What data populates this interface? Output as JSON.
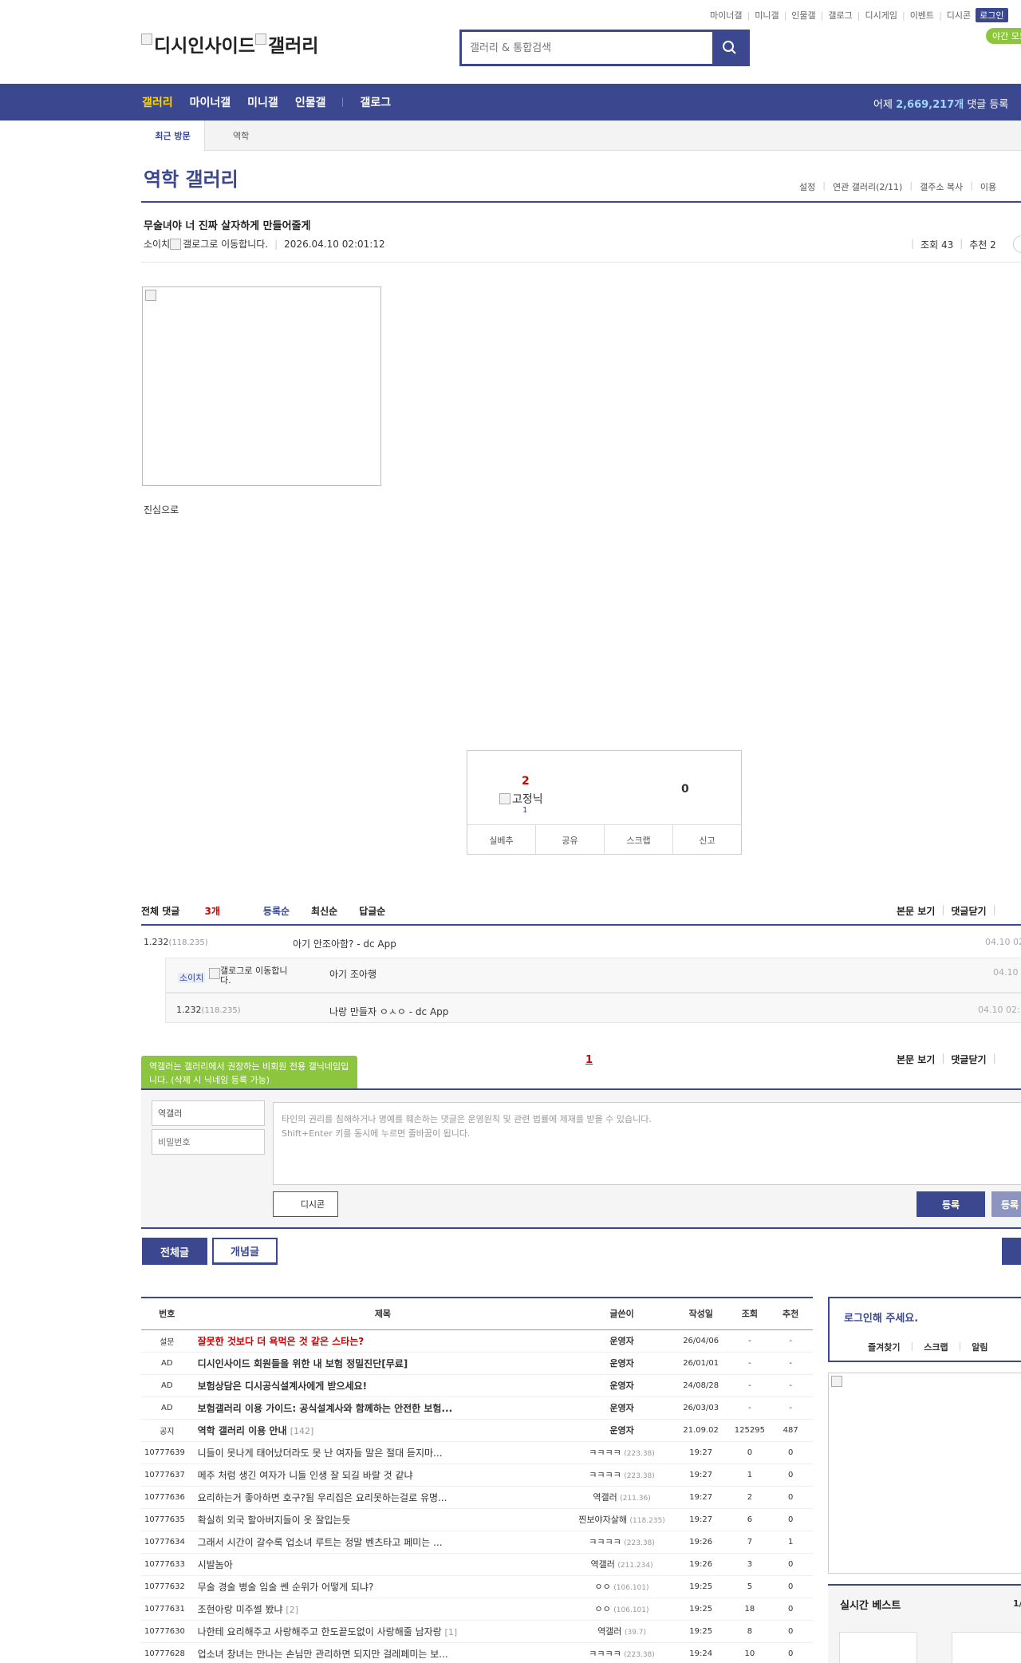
{
  "topnav": {
    "items": [
      "마이너갤",
      "미니갤",
      "인물갤",
      "갤로그",
      "디시게임",
      "이벤트",
      "디시콘"
    ],
    "login": "로그인",
    "night": "야간 모드"
  },
  "header": {
    "logo_text_1": "디시인사이드",
    "logo_text_2": "갤러리",
    "search_placeholder": "갤러리 & 통합검색"
  },
  "gnb": {
    "items": [
      "갤러리",
      "마이너갤",
      "미니갤",
      "인물갤"
    ],
    "item_extra": "갤로그",
    "stat_prefix": "어제 ",
    "stat_value": "2,669,217개",
    "stat_suffix": " 댓글 등록"
  },
  "visit": {
    "title": "최근 방문",
    "item": "역학"
  },
  "gallery": {
    "title": "역학 갤러리",
    "links": [
      "설정",
      "연관 갤러리(2/11)",
      "갤주소 복사",
      "이용"
    ]
  },
  "post": {
    "title": "무술녀야 너 진짜 살자하게 만들어줄게",
    "author": "소이치",
    "gallog_alt": "갤로그로 이동합니다.",
    "date": "2026.04.10 02:01:12",
    "views": "조회 43",
    "recommend": "추천 2",
    "body_text": "진심으로"
  },
  "reco": {
    "up": "2",
    "fixed_label": "고정닉",
    "fixed_count": "1",
    "down": "0",
    "buttons": [
      "실베추",
      "공유",
      "스크랩",
      "신고"
    ]
  },
  "comments": {
    "header_prefix": "전체 댓글 ",
    "count": "3개",
    "tabs": [
      "등록순",
      "최신순",
      "답글순"
    ],
    "right": [
      "본문 보기",
      "댓글닫기"
    ],
    "items": [
      {
        "nick": "1.232",
        "ip": "(118.235)",
        "text": "아기 안조아함? - dc App",
        "date": "04.10 02"
      },
      {
        "nick": "소이치",
        "gallog": "갤로그로 이동합니다.",
        "text": "아기 조아행",
        "date": "04.10"
      },
      {
        "nick": "1.232",
        "ip": "(118.235)",
        "text": "나랑 만들자 ㅇㅅㅇ - dc App",
        "date": "04.10 02:"
      }
    ],
    "page": "1",
    "right2": [
      "본문 보기",
      "댓글닫기"
    ]
  },
  "write": {
    "tooltip": "역갤러는 갤러리에서 권장하는 비회원 전용 갤닉네임입니다. (삭제 시 닉네임 등록 가능)",
    "nick_value": "역갤러",
    "password_placeholder": "비밀번호",
    "textarea_placeholder_1": "타인의 권리를 침해하거나 명예를 훼손하는 댓글은 운영원칙 및 관련 법률에 제재를 받을 수 있습니다.",
    "textarea_placeholder_2": "Shift+Enter 키를 동시에 누르면 줄바꿈이 됩니다.",
    "dccon": "디시콘",
    "register": "등록",
    "register2": "등록"
  },
  "listbtns": {
    "all": "전체글",
    "concept": "개념글"
  },
  "table": {
    "headers": [
      "번호",
      "제목",
      "글쓴이",
      "작성일",
      "조회",
      "추천"
    ],
    "rows": [
      {
        "num": "설문",
        "title": "잘못한 것보다 더 욕먹은 것 같은 스타는?",
        "writer": "운영자",
        "ip": "",
        "date": "26/04/06",
        "views": "-",
        "rec": "-",
        "style": "red"
      },
      {
        "num": "AD",
        "title": "디시인사이드 회원들을 위한 내 보험 정밀진단[무료]",
        "writer": "운영자",
        "ip": "",
        "date": "26/01/01",
        "views": "-",
        "rec": "-",
        "style": "b"
      },
      {
        "num": "AD",
        "title": "보험상담은 디시공식설계사에게 받으세요!",
        "writer": "운영자",
        "ip": "",
        "date": "24/08/28",
        "views": "-",
        "rec": "-",
        "style": "b"
      },
      {
        "num": "AD",
        "title": "보험갤러리 이용 가이드: 공식설계사와 함께하는 안전한 보험...",
        "writer": "운영자",
        "ip": "",
        "date": "26/03/03",
        "views": "-",
        "rec": "-",
        "style": "b"
      },
      {
        "num": "공지",
        "title": "역학 갤러리 이용 안내",
        "reply": "[142]",
        "writer": "운영자",
        "ip": "",
        "date": "21.09.02",
        "views": "125295",
        "rec": "487",
        "style": "b"
      },
      {
        "num": "10777639",
        "title": "니들이 못나게 태어났더라도 못 난 여자들 말은 절대 듣지마...",
        "writer": "ㅋㅋㅋㅋ",
        "ip": "(223.38)",
        "date": "19:27",
        "views": "0",
        "rec": "0"
      },
      {
        "num": "10777637",
        "title": "메주 처럼 생긴 여자가 니들 인생 잘 되길 바랄 것 같냐",
        "writer": "ㅋㅋㅋㅋ",
        "ip": "(223.38)",
        "date": "19:27",
        "views": "1",
        "rec": "0"
      },
      {
        "num": "10777636",
        "title": "요리하는거 좋아하면 호구?됨 우리집은 요리못하는걸로 유명...",
        "writer": "역갤러",
        "ip": "(211.36)",
        "date": "19:27",
        "views": "2",
        "rec": "0"
      },
      {
        "num": "10777635",
        "title": "확실히 외국 할아버지들이 옷 잘입는듯",
        "writer": "찐보야자살해",
        "ip": "(118.235)",
        "date": "19:27",
        "views": "6",
        "rec": "0"
      },
      {
        "num": "10777634",
        "title": "그래서 시간이 갈수록 업소녀 루트는 정말 벤츠타고 페미는 ...",
        "writer": "ㅋㅋㅋㅋ",
        "ip": "(223.38)",
        "date": "19:26",
        "views": "7",
        "rec": "1"
      },
      {
        "num": "10777633",
        "title": "시발놈아",
        "writer": "역갤러",
        "ip": "(211.234)",
        "date": "19:26",
        "views": "3",
        "rec": "0"
      },
      {
        "num": "10777632",
        "title": "무술 경술 병술 임술 쎈 순위가 어떻게 되냐?",
        "writer": "ㅇㅇ",
        "ip": "(106.101)",
        "date": "19:25",
        "views": "5",
        "rec": "0"
      },
      {
        "num": "10777631",
        "title": "조현아랑 미주썰 봤냐",
        "reply": "[2]",
        "writer": "ㅇㅇ",
        "ip": "(106.101)",
        "date": "19:25",
        "views": "18",
        "rec": "0"
      },
      {
        "num": "10777630",
        "title": "나한테 요리해주고 사랑해주고 한도끝도없이 사랑해줄 남자랑",
        "reply": "[1]",
        "writer": "역갤러",
        "ip": "(39.7)",
        "date": "19:25",
        "views": "8",
        "rec": "0"
      },
      {
        "num": "10777628",
        "title": "업소녀 창녀는 만나는 손님만 관리하면 되지만 걸레페미는 보...",
        "writer": "ㅋㅋㅋㅋ",
        "ip": "(223.38)",
        "date": "19:24",
        "views": "10",
        "rec": "0"
      }
    ]
  },
  "side": {
    "login_title": "로그인해 주세요.",
    "links": [
      "즐겨찾기",
      "스크랩",
      "알림"
    ],
    "best_title": "실시간 베스트",
    "best_page": "1/"
  },
  "colors": {
    "primary": "#3b4890",
    "accent_red": "#cc0000",
    "green": "#8cc63f"
  }
}
